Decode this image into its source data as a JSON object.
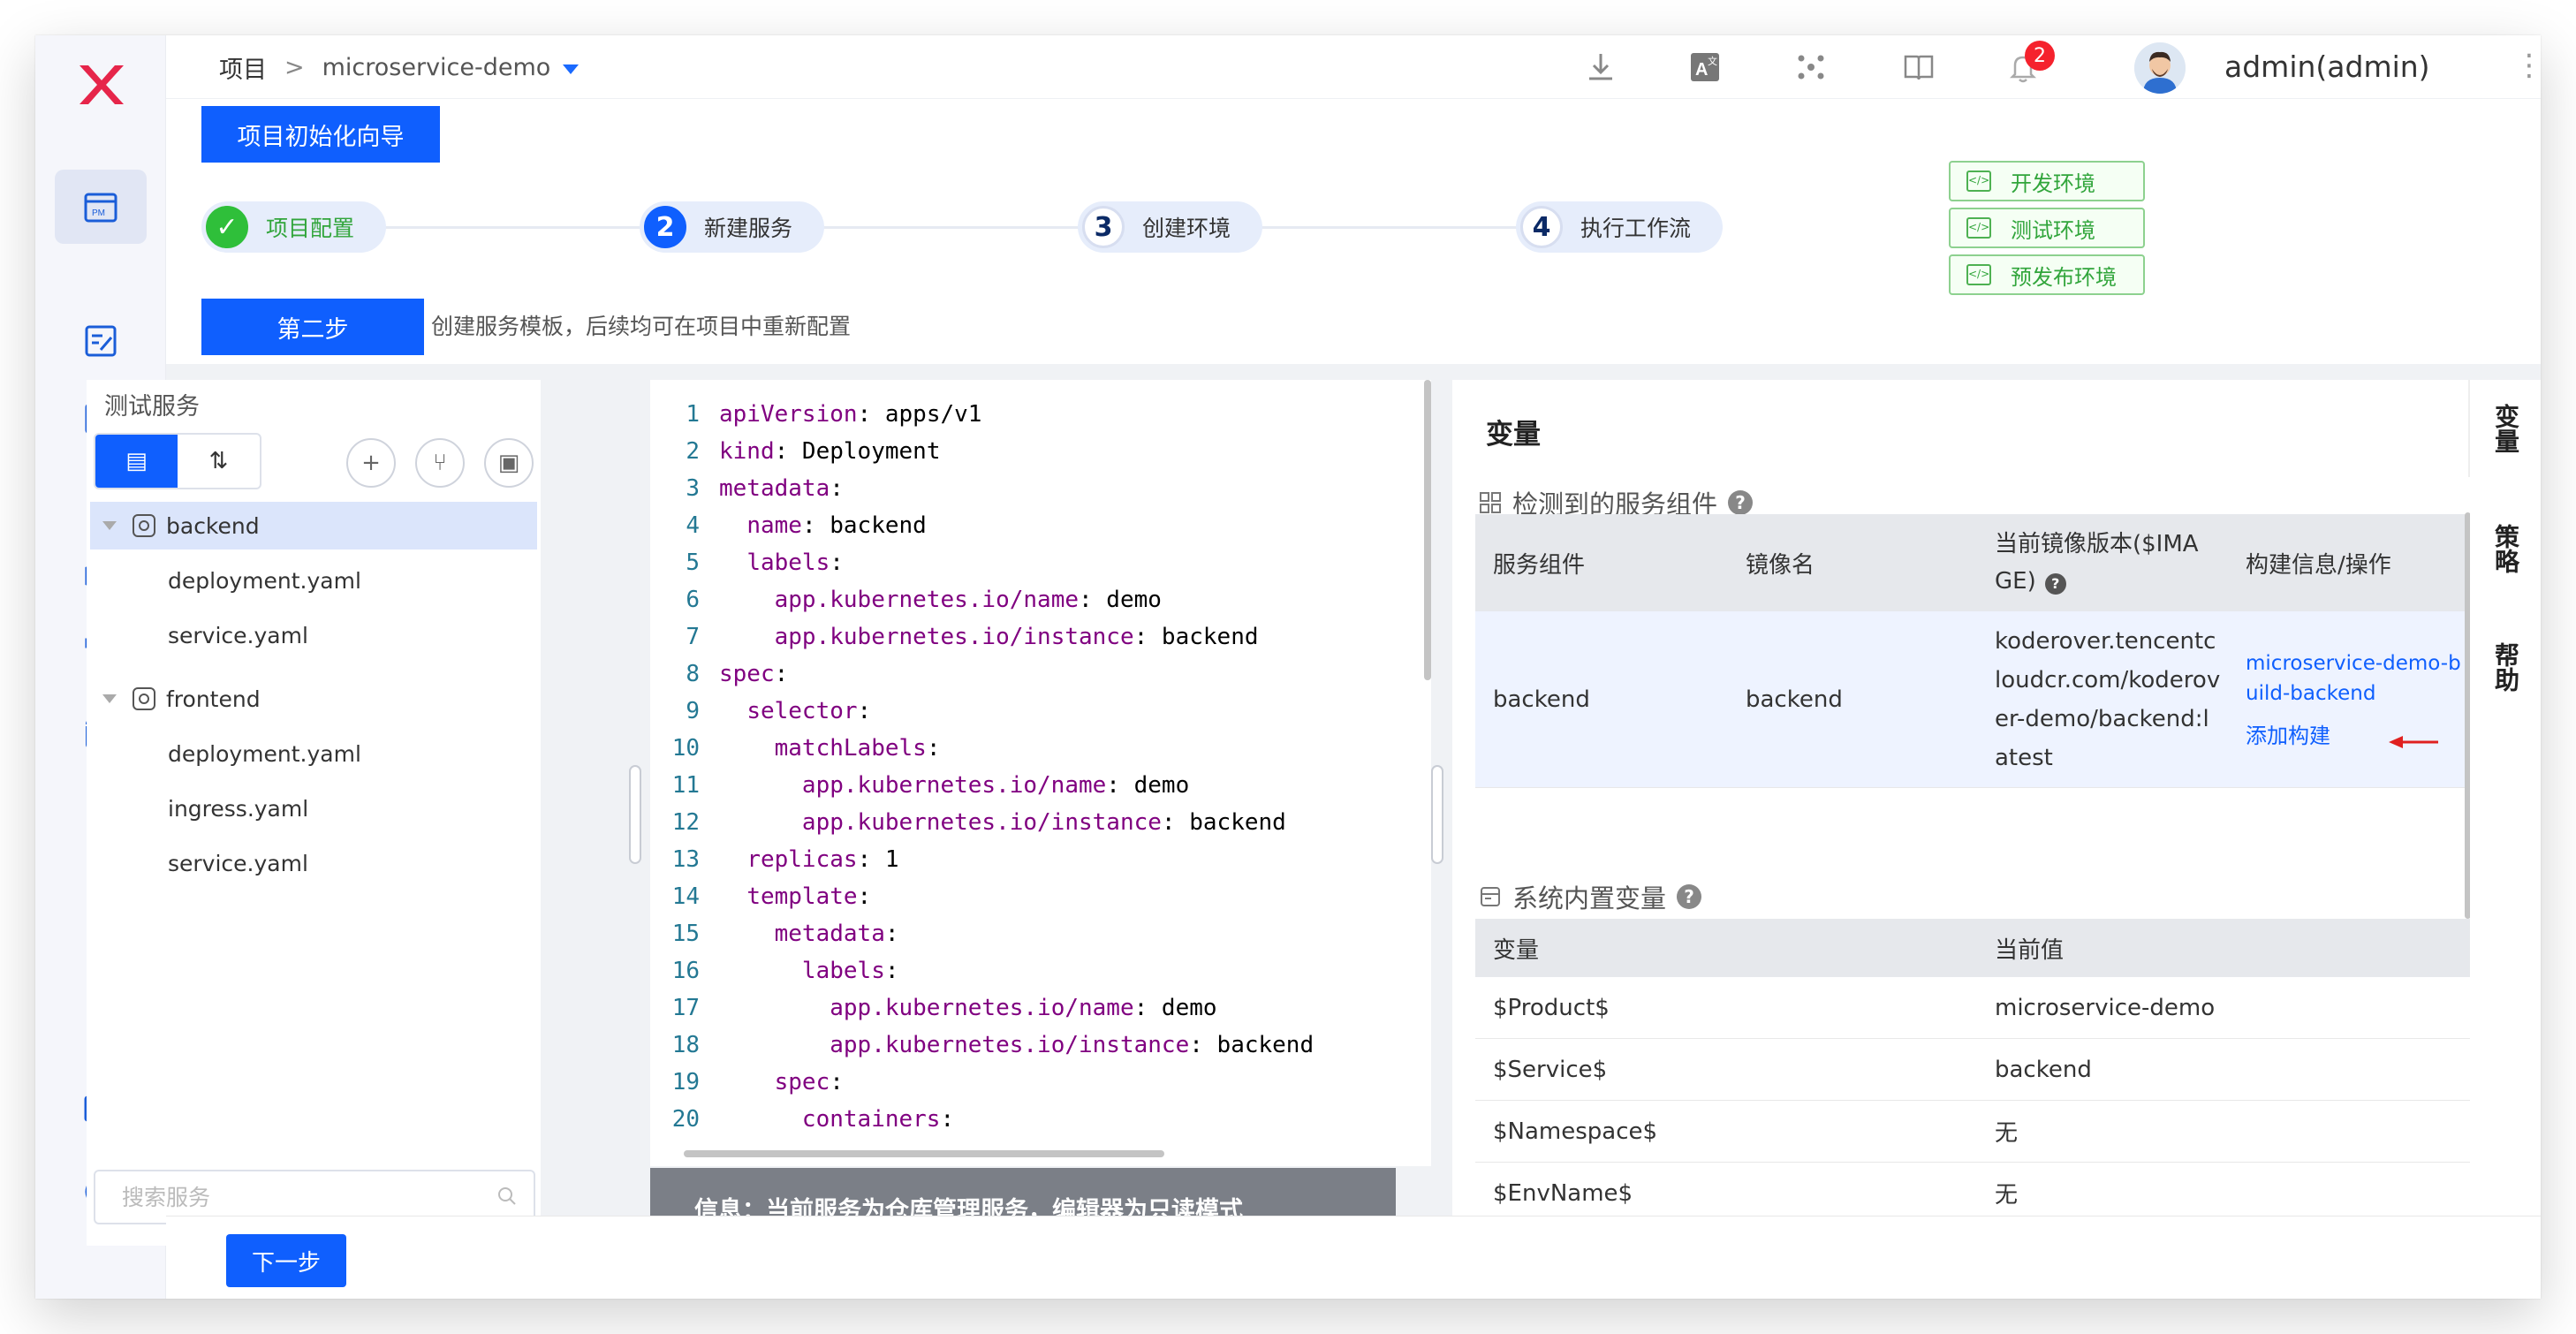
{
  "topbar": {
    "breadcrumb_root": "项目",
    "breadcrumb_sep": ">",
    "project": "microservice-demo",
    "notification_count": "2",
    "username": "admin(admin)",
    "more": "⋮"
  },
  "wizard": {
    "title_button": "项目初始化向导",
    "steps": [
      {
        "num": "✓",
        "label": "项目配置",
        "state": "done"
      },
      {
        "num": "2",
        "label": "新建服务",
        "state": "current"
      },
      {
        "num": "3",
        "label": "创建环境",
        "state": "todo"
      },
      {
        "num": "4",
        "label": "执行工作流",
        "state": "todo"
      }
    ],
    "environments": [
      "开发环境",
      "测试环境",
      "预发布环境"
    ],
    "step_badge": "第二步",
    "step_desc": "创建服务模板，后续均可在项目中重新配置"
  },
  "tree": {
    "title": "测试服务",
    "search_placeholder": "搜索服务",
    "services": [
      {
        "name": "backend",
        "files": [
          "deployment.yaml",
          "service.yaml"
        ]
      },
      {
        "name": "frontend",
        "files": [
          "deployment.yaml",
          "ingress.yaml",
          "service.yaml"
        ]
      }
    ]
  },
  "editor": {
    "lines": [
      {
        "n": "1",
        "indent": "",
        "key": "apiVersion",
        "val": " apps/v1"
      },
      {
        "n": "2",
        "indent": "",
        "key": "kind",
        "val": " Deployment"
      },
      {
        "n": "3",
        "indent": "",
        "key": "metadata",
        "val": ""
      },
      {
        "n": "4",
        "indent": "  ",
        "key": "name",
        "val": " backend"
      },
      {
        "n": "5",
        "indent": "  ",
        "key": "labels",
        "val": ""
      },
      {
        "n": "6",
        "indent": "    ",
        "key": "app.kubernetes.io/name",
        "val": " demo"
      },
      {
        "n": "7",
        "indent": "    ",
        "key": "app.kubernetes.io/instance",
        "val": " backend"
      },
      {
        "n": "8",
        "indent": "",
        "key": "spec",
        "val": ""
      },
      {
        "n": "9",
        "indent": "  ",
        "key": "selector",
        "val": ""
      },
      {
        "n": "10",
        "indent": "    ",
        "key": "matchLabels",
        "val": ""
      },
      {
        "n": "11",
        "indent": "      ",
        "key": "app.kubernetes.io/name",
        "val": " demo"
      },
      {
        "n": "12",
        "indent": "      ",
        "key": "app.kubernetes.io/instance",
        "val": " backend"
      },
      {
        "n": "13",
        "indent": "  ",
        "key": "replicas",
        "val": " 1"
      },
      {
        "n": "14",
        "indent": "  ",
        "key": "template",
        "val": ""
      },
      {
        "n": "15",
        "indent": "    ",
        "key": "metadata",
        "val": ""
      },
      {
        "n": "16",
        "indent": "      ",
        "key": "labels",
        "val": ""
      },
      {
        "n": "17",
        "indent": "        ",
        "key": "app.kubernetes.io/name",
        "val": " demo"
      },
      {
        "n": "18",
        "indent": "        ",
        "key": "app.kubernetes.io/instance",
        "val": " backend"
      },
      {
        "n": "19",
        "indent": "    ",
        "key": "spec",
        "val": ""
      },
      {
        "n": "20",
        "indent": "      ",
        "key": "containers",
        "val": ""
      }
    ],
    "info": "信息：当前服务为仓库管理服务，编辑器为只读模式"
  },
  "variables": {
    "title": "变量",
    "components_title": "检测到的服务组件",
    "components_headers": [
      "服务组件",
      "镜像名",
      "当前镜像版本($IMAGE)",
      "构建信息/操作"
    ],
    "components_rows": [
      {
        "component": "backend",
        "image": "backend",
        "version": "koderover.tencentcloudcr.com/koderover-demo/backend:latest",
        "build_link": "microservice-demo-build-backend",
        "add_build": "添加构建"
      }
    ],
    "system_title": "系统内置变量",
    "system_headers": [
      "变量",
      "当前值"
    ],
    "system_rows": [
      {
        "name": "$Product$",
        "value": "microservice-demo"
      },
      {
        "name": "$Service$",
        "value": "backend"
      },
      {
        "name": "$Namespace$",
        "value": "无"
      },
      {
        "name": "$EnvName$",
        "value": "无"
      }
    ]
  },
  "side_tabs": [
    "变量",
    "策略",
    "帮助"
  ],
  "footer": {
    "next": "下一步"
  },
  "colors": {
    "primary": "#0f5ffe",
    "success": "#2fbf3a",
    "brand": "#e6254a"
  }
}
